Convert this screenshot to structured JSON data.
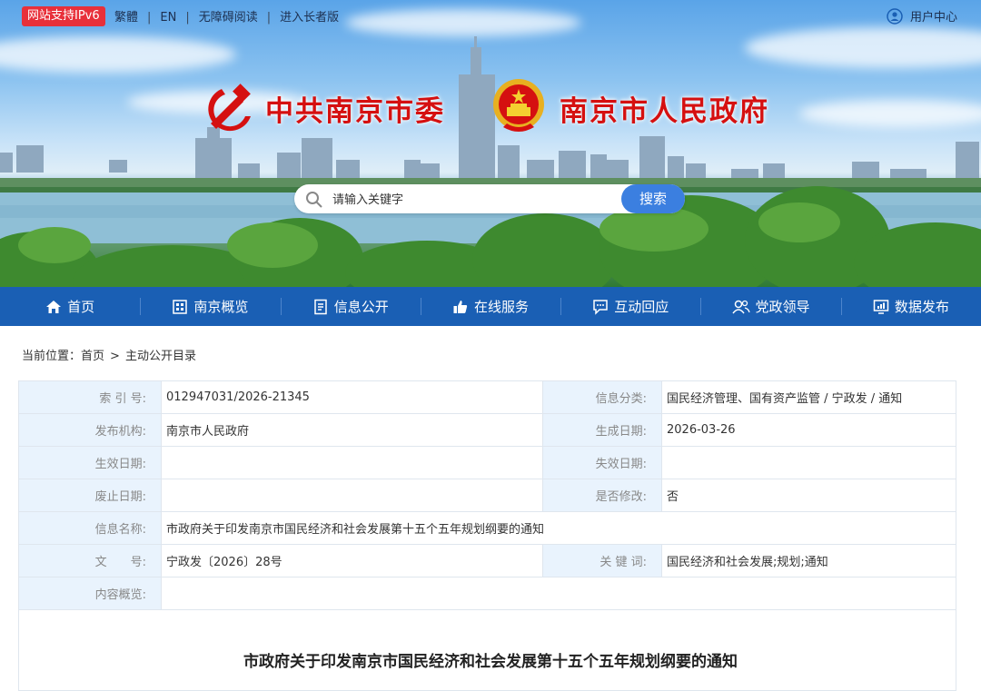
{
  "topbar": {
    "ipv6_badge": "网站支持IPv6",
    "links": [
      "繁體",
      "EN",
      "无障碍阅读",
      "进入长者版"
    ],
    "separator": "|",
    "user_center": "用户中心"
  },
  "banner": {
    "title_party": "中共南京市委",
    "title_gov": "南京市人民政府"
  },
  "search": {
    "placeholder": "请输入关键字",
    "button": "搜索"
  },
  "nav": [
    {
      "label": "首页",
      "icon": "home-icon"
    },
    {
      "label": "南京概览",
      "icon": "building-icon"
    },
    {
      "label": "信息公开",
      "icon": "document-icon"
    },
    {
      "label": "在线服务",
      "icon": "thumbs-up-icon"
    },
    {
      "label": "互动回应",
      "icon": "chat-icon"
    },
    {
      "label": "党政领导",
      "icon": "people-icon"
    },
    {
      "label": "数据发布",
      "icon": "monitor-chart-icon"
    }
  ],
  "breadcrumb": {
    "prefix": "当前位置：",
    "home": "首页",
    "sep": ">",
    "current": "主动公开目录"
  },
  "meta": {
    "index_label": "索 引 号:",
    "index_value": "012947031/2026-21345",
    "category_label": "信息分类:",
    "category_value": "国民经济管理、国有资产监管 / 宁政发 / 通知",
    "publisher_label": "发布机构:",
    "publisher_value": "南京市人民政府",
    "created_label": "生成日期:",
    "created_value": "2026-03-26",
    "effective_label": "生效日期:",
    "effective_value": "",
    "expire_label": "失效日期:",
    "expire_value": "",
    "abolish_label": "废止日期:",
    "abolish_value": "",
    "modified_label": "是否修改:",
    "modified_value": "否",
    "name_label": "信息名称:",
    "name_value": "市政府关于印发南京市国民经济和社会发展第十五个五年规划纲要的通知",
    "docno_label": "文　　号:",
    "docno_value": "宁政发〔2026〕28号",
    "keywords_label": "关 键 词:",
    "keywords_value": "国民经济和社会发展;规划;通知",
    "summary_label": "内容概览:",
    "summary_value": ""
  },
  "document": {
    "title": "市政府关于印发南京市国民经济和社会发展第十五个五年规划纲要的通知"
  },
  "colors": {
    "nav_bg": "#1a5fb4",
    "title_red": "#d51010",
    "search_button": "#3b7fe0",
    "label_cell_bg": "#e9f3fd"
  }
}
